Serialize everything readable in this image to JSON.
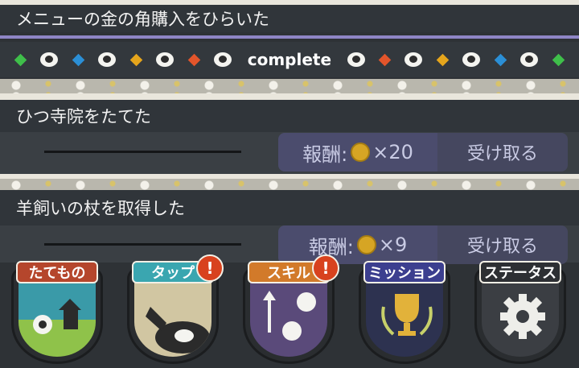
{
  "missions": [
    {
      "title": "メニューの金の角購入をひらいた",
      "status": "complete"
    },
    {
      "title": "ひつ寺院をたてた",
      "reward_label": "報酬:",
      "reward_amount": "×20",
      "claim_label": "受け取る"
    },
    {
      "title": "羊飼いの杖を取得した",
      "reward_label": "報酬:",
      "reward_amount": "×9",
      "claim_label": "受け取る"
    }
  ],
  "nav": {
    "items": [
      {
        "label": "たてもの",
        "color": "#b5462c",
        "badge": ""
      },
      {
        "label": "タップ",
        "color": "#3aa6b0",
        "badge": "!"
      },
      {
        "label": "スキル",
        "color": "#d27a2a",
        "badge": "!"
      },
      {
        "label": "ミッション",
        "color": "#3c3f8f",
        "badge": ""
      },
      {
        "label": "ステータス",
        "color": "#2d2f33",
        "badge": ""
      }
    ]
  },
  "colors": {
    "diamond_green": "#3fbf4a",
    "diamond_blue": "#2b8fd6",
    "diamond_yellow": "#e5a51c",
    "diamond_red": "#e3552b",
    "separator": "#8f86c6"
  },
  "icons": [
    "diamond-green-icon",
    "sheep-icon",
    "diamond-blue-icon",
    "diamond-yellow-icon",
    "diamond-red-icon",
    "coin-icon",
    "gear-icon",
    "trophy-icon",
    "church-icon"
  ]
}
